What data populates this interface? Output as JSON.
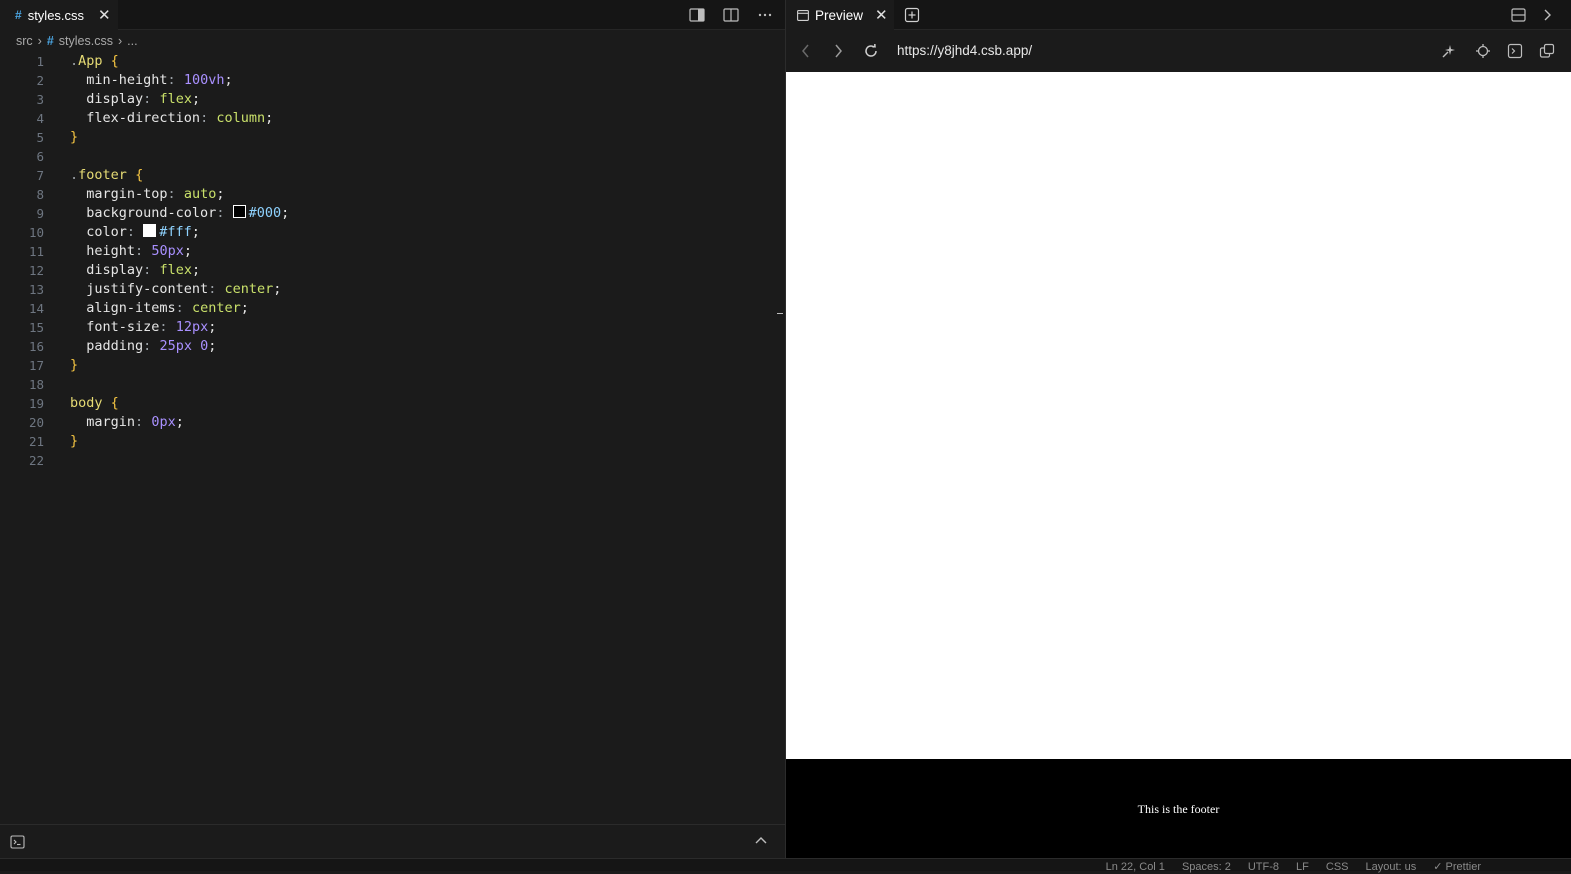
{
  "editor": {
    "tab": {
      "icon": "#",
      "label": "styles.css"
    },
    "breadcrumb": {
      "folder": "src",
      "file_icon": "#",
      "file": "styles.css",
      "ellipsis": "..."
    },
    "lines": [
      {
        "n": "1",
        "tokens": [
          [
            "dot",
            "."
          ],
          [
            "sel",
            "App"
          ],
          [
            "plain",
            " "
          ],
          [
            "brace",
            "{"
          ]
        ]
      },
      {
        "n": "2",
        "tokens": [
          [
            "plain",
            "  "
          ],
          [
            "prop",
            "min-height"
          ],
          [
            "punct",
            ":"
          ],
          [
            "plain",
            " "
          ],
          [
            "num",
            "100vh"
          ],
          [
            "semi",
            ";"
          ]
        ]
      },
      {
        "n": "3",
        "tokens": [
          [
            "plain",
            "  "
          ],
          [
            "prop",
            "display"
          ],
          [
            "punct",
            ":"
          ],
          [
            "plain",
            " "
          ],
          [
            "val",
            "flex"
          ],
          [
            "semi",
            ";"
          ]
        ]
      },
      {
        "n": "4",
        "tokens": [
          [
            "plain",
            "  "
          ],
          [
            "prop",
            "flex-direction"
          ],
          [
            "punct",
            ":"
          ],
          [
            "plain",
            " "
          ],
          [
            "val",
            "column"
          ],
          [
            "semi",
            ";"
          ]
        ]
      },
      {
        "n": "5",
        "tokens": [
          [
            "brace",
            "}"
          ]
        ]
      },
      {
        "n": "6",
        "tokens": []
      },
      {
        "n": "7",
        "tokens": [
          [
            "dot",
            "."
          ],
          [
            "sel",
            "footer"
          ],
          [
            "plain",
            " "
          ],
          [
            "brace",
            "{"
          ]
        ]
      },
      {
        "n": "8",
        "tokens": [
          [
            "plain",
            "  "
          ],
          [
            "prop",
            "margin-top"
          ],
          [
            "punct",
            ":"
          ],
          [
            "plain",
            " "
          ],
          [
            "val",
            "auto"
          ],
          [
            "semi",
            ";"
          ]
        ]
      },
      {
        "n": "9",
        "tokens": [
          [
            "plain",
            "  "
          ],
          [
            "prop",
            "background-color"
          ],
          [
            "punct",
            ":"
          ],
          [
            "plain",
            " "
          ],
          [
            "swatch",
            "#000000"
          ],
          [
            "hex",
            "#000"
          ],
          [
            "semi",
            ";"
          ]
        ]
      },
      {
        "n": "10",
        "tokens": [
          [
            "plain",
            "  "
          ],
          [
            "prop",
            "color"
          ],
          [
            "punct",
            ":"
          ],
          [
            "plain",
            " "
          ],
          [
            "swatch",
            "#ffffff"
          ],
          [
            "hex",
            "#fff"
          ],
          [
            "semi",
            ";"
          ]
        ]
      },
      {
        "n": "11",
        "tokens": [
          [
            "plain",
            "  "
          ],
          [
            "prop",
            "height"
          ],
          [
            "punct",
            ":"
          ],
          [
            "plain",
            " "
          ],
          [
            "num",
            "50px"
          ],
          [
            "semi",
            ";"
          ]
        ]
      },
      {
        "n": "12",
        "tokens": [
          [
            "plain",
            "  "
          ],
          [
            "prop",
            "display"
          ],
          [
            "punct",
            ":"
          ],
          [
            "plain",
            " "
          ],
          [
            "val",
            "flex"
          ],
          [
            "semi",
            ";"
          ]
        ]
      },
      {
        "n": "13",
        "tokens": [
          [
            "plain",
            "  "
          ],
          [
            "prop",
            "justify-content"
          ],
          [
            "punct",
            ":"
          ],
          [
            "plain",
            " "
          ],
          [
            "val",
            "center"
          ],
          [
            "semi",
            ";"
          ]
        ]
      },
      {
        "n": "14",
        "tokens": [
          [
            "plain",
            "  "
          ],
          [
            "prop",
            "align-items"
          ],
          [
            "punct",
            ":"
          ],
          [
            "plain",
            " "
          ],
          [
            "val",
            "center"
          ],
          [
            "semi",
            ";"
          ]
        ]
      },
      {
        "n": "15",
        "tokens": [
          [
            "plain",
            "  "
          ],
          [
            "prop",
            "font-size"
          ],
          [
            "punct",
            ":"
          ],
          [
            "plain",
            " "
          ],
          [
            "num",
            "12px"
          ],
          [
            "semi",
            ";"
          ]
        ]
      },
      {
        "n": "16",
        "tokens": [
          [
            "plain",
            "  "
          ],
          [
            "prop",
            "padding"
          ],
          [
            "punct",
            ":"
          ],
          [
            "plain",
            " "
          ],
          [
            "num",
            "25px"
          ],
          [
            "plain",
            " "
          ],
          [
            "num",
            "0"
          ],
          [
            "semi",
            ";"
          ]
        ]
      },
      {
        "n": "17",
        "tokens": [
          [
            "brace",
            "}"
          ]
        ]
      },
      {
        "n": "18",
        "tokens": []
      },
      {
        "n": "19",
        "tokens": [
          [
            "sel",
            "body"
          ],
          [
            "plain",
            " "
          ],
          [
            "brace",
            "{"
          ]
        ]
      },
      {
        "n": "20",
        "tokens": [
          [
            "plain",
            "  "
          ],
          [
            "prop",
            "margin"
          ],
          [
            "punct",
            ":"
          ],
          [
            "plain",
            " "
          ],
          [
            "num",
            "0px"
          ],
          [
            "semi",
            ";"
          ]
        ]
      },
      {
        "n": "21",
        "tokens": [
          [
            "brace",
            "}"
          ]
        ]
      },
      {
        "n": "22",
        "tokens": []
      }
    ]
  },
  "preview": {
    "tab_label": "Preview",
    "url": "https://y8jhd4.csb.app/",
    "footer_text": "This is the footer"
  },
  "statusbar": {
    "items": [
      "Ln 22, Col 1",
      "Spaces: 2",
      "UTF-8",
      "LF",
      "CSS",
      "Layout: us",
      "✓ Prettier"
    ]
  },
  "colors": {
    "editor_bg": "#1b1b1b",
    "accent_hash": "#4aa3df",
    "selector": "#e6db74",
    "brace": "#f5c542",
    "value_keyword": "#c9e06a",
    "value_number": "#a990ff",
    "hex_color": "#8fd3ff"
  }
}
